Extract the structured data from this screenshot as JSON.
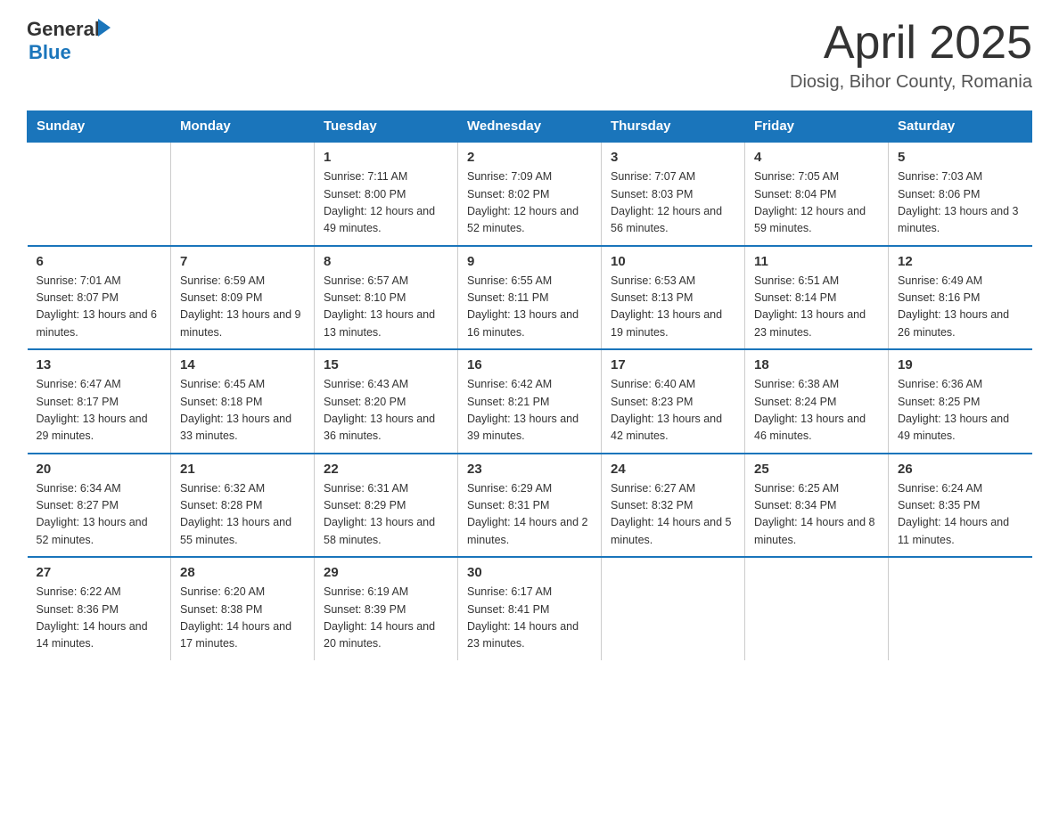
{
  "header": {
    "logo_general": "General",
    "logo_blue": "Blue",
    "month_title": "April 2025",
    "location": "Diosig, Bihor County, Romania"
  },
  "days_of_week": [
    "Sunday",
    "Monday",
    "Tuesday",
    "Wednesday",
    "Thursday",
    "Friday",
    "Saturday"
  ],
  "weeks": [
    [
      {
        "num": "",
        "info": ""
      },
      {
        "num": "",
        "info": ""
      },
      {
        "num": "1",
        "info": "Sunrise: 7:11 AM\nSunset: 8:00 PM\nDaylight: 12 hours\nand 49 minutes."
      },
      {
        "num": "2",
        "info": "Sunrise: 7:09 AM\nSunset: 8:02 PM\nDaylight: 12 hours\nand 52 minutes."
      },
      {
        "num": "3",
        "info": "Sunrise: 7:07 AM\nSunset: 8:03 PM\nDaylight: 12 hours\nand 56 minutes."
      },
      {
        "num": "4",
        "info": "Sunrise: 7:05 AM\nSunset: 8:04 PM\nDaylight: 12 hours\nand 59 minutes."
      },
      {
        "num": "5",
        "info": "Sunrise: 7:03 AM\nSunset: 8:06 PM\nDaylight: 13 hours\nand 3 minutes."
      }
    ],
    [
      {
        "num": "6",
        "info": "Sunrise: 7:01 AM\nSunset: 8:07 PM\nDaylight: 13 hours\nand 6 minutes."
      },
      {
        "num": "7",
        "info": "Sunrise: 6:59 AM\nSunset: 8:09 PM\nDaylight: 13 hours\nand 9 minutes."
      },
      {
        "num": "8",
        "info": "Sunrise: 6:57 AM\nSunset: 8:10 PM\nDaylight: 13 hours\nand 13 minutes."
      },
      {
        "num": "9",
        "info": "Sunrise: 6:55 AM\nSunset: 8:11 PM\nDaylight: 13 hours\nand 16 minutes."
      },
      {
        "num": "10",
        "info": "Sunrise: 6:53 AM\nSunset: 8:13 PM\nDaylight: 13 hours\nand 19 minutes."
      },
      {
        "num": "11",
        "info": "Sunrise: 6:51 AM\nSunset: 8:14 PM\nDaylight: 13 hours\nand 23 minutes."
      },
      {
        "num": "12",
        "info": "Sunrise: 6:49 AM\nSunset: 8:16 PM\nDaylight: 13 hours\nand 26 minutes."
      }
    ],
    [
      {
        "num": "13",
        "info": "Sunrise: 6:47 AM\nSunset: 8:17 PM\nDaylight: 13 hours\nand 29 minutes."
      },
      {
        "num": "14",
        "info": "Sunrise: 6:45 AM\nSunset: 8:18 PM\nDaylight: 13 hours\nand 33 minutes."
      },
      {
        "num": "15",
        "info": "Sunrise: 6:43 AM\nSunset: 8:20 PM\nDaylight: 13 hours\nand 36 minutes."
      },
      {
        "num": "16",
        "info": "Sunrise: 6:42 AM\nSunset: 8:21 PM\nDaylight: 13 hours\nand 39 minutes."
      },
      {
        "num": "17",
        "info": "Sunrise: 6:40 AM\nSunset: 8:23 PM\nDaylight: 13 hours\nand 42 minutes."
      },
      {
        "num": "18",
        "info": "Sunrise: 6:38 AM\nSunset: 8:24 PM\nDaylight: 13 hours\nand 46 minutes."
      },
      {
        "num": "19",
        "info": "Sunrise: 6:36 AM\nSunset: 8:25 PM\nDaylight: 13 hours\nand 49 minutes."
      }
    ],
    [
      {
        "num": "20",
        "info": "Sunrise: 6:34 AM\nSunset: 8:27 PM\nDaylight: 13 hours\nand 52 minutes."
      },
      {
        "num": "21",
        "info": "Sunrise: 6:32 AM\nSunset: 8:28 PM\nDaylight: 13 hours\nand 55 minutes."
      },
      {
        "num": "22",
        "info": "Sunrise: 6:31 AM\nSunset: 8:29 PM\nDaylight: 13 hours\nand 58 minutes."
      },
      {
        "num": "23",
        "info": "Sunrise: 6:29 AM\nSunset: 8:31 PM\nDaylight: 14 hours\nand 2 minutes."
      },
      {
        "num": "24",
        "info": "Sunrise: 6:27 AM\nSunset: 8:32 PM\nDaylight: 14 hours\nand 5 minutes."
      },
      {
        "num": "25",
        "info": "Sunrise: 6:25 AM\nSunset: 8:34 PM\nDaylight: 14 hours\nand 8 minutes."
      },
      {
        "num": "26",
        "info": "Sunrise: 6:24 AM\nSunset: 8:35 PM\nDaylight: 14 hours\nand 11 minutes."
      }
    ],
    [
      {
        "num": "27",
        "info": "Sunrise: 6:22 AM\nSunset: 8:36 PM\nDaylight: 14 hours\nand 14 minutes."
      },
      {
        "num": "28",
        "info": "Sunrise: 6:20 AM\nSunset: 8:38 PM\nDaylight: 14 hours\nand 17 minutes."
      },
      {
        "num": "29",
        "info": "Sunrise: 6:19 AM\nSunset: 8:39 PM\nDaylight: 14 hours\nand 20 minutes."
      },
      {
        "num": "30",
        "info": "Sunrise: 6:17 AM\nSunset: 8:41 PM\nDaylight: 14 hours\nand 23 minutes."
      },
      {
        "num": "",
        "info": ""
      },
      {
        "num": "",
        "info": ""
      },
      {
        "num": "",
        "info": ""
      }
    ]
  ]
}
